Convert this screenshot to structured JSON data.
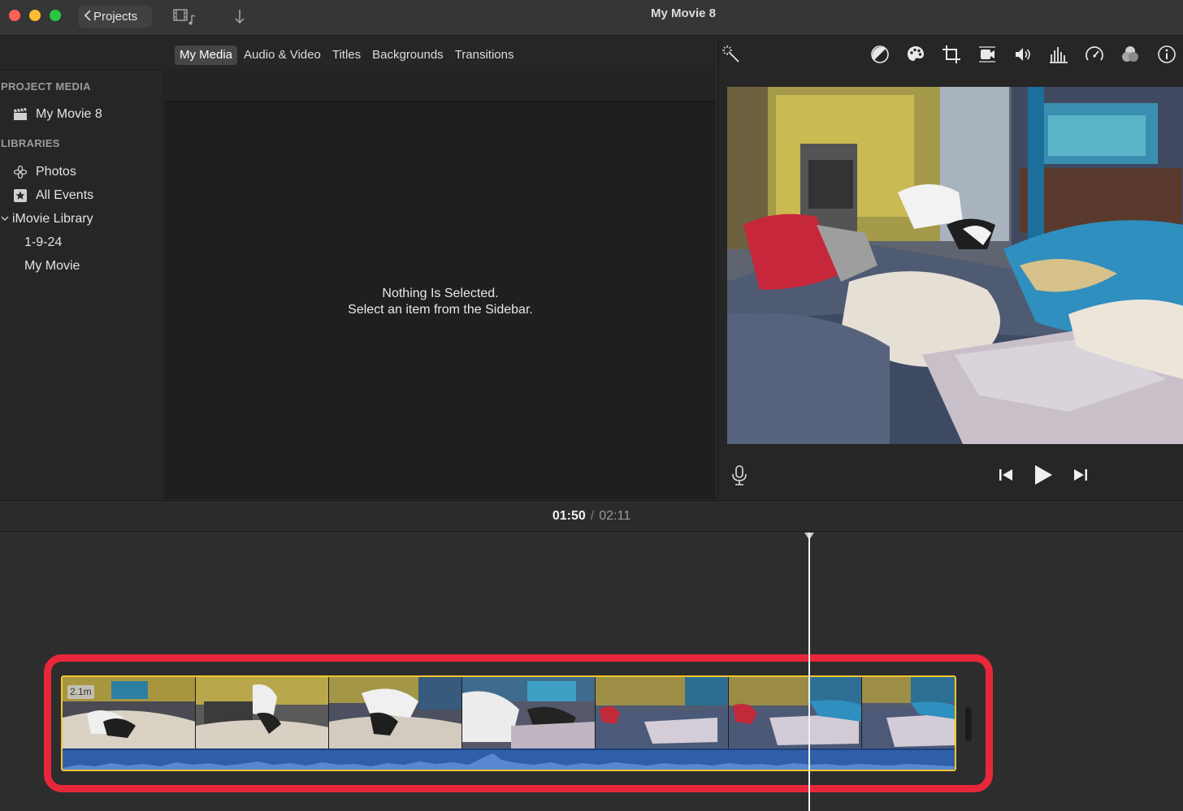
{
  "window": {
    "title": "My Movie 8"
  },
  "toolbar": {
    "projects_label": "Projects"
  },
  "tabs": [
    {
      "label": "My Media",
      "active": true
    },
    {
      "label": "Audio & Video"
    },
    {
      "label": "Titles"
    },
    {
      "label": "Backgrounds"
    },
    {
      "label": "Transitions"
    }
  ],
  "sidebar": {
    "project_media_title": "PROJECT MEDIA",
    "project_item": "My Movie 8",
    "libraries_title": "LIBRARIES",
    "items": [
      {
        "label": "Photos",
        "icon": "photos-icon"
      },
      {
        "label": "All Events",
        "icon": "star-icon"
      },
      {
        "label": "iMovie Library",
        "icon": "chevron-down-icon"
      },
      {
        "label": "1-9-24"
      },
      {
        "label": "My Movie"
      }
    ]
  },
  "browser": {
    "empty_line1": "Nothing Is Selected.",
    "empty_line2": "Select an item from the Sidebar."
  },
  "viewer": {
    "tool_icons": [
      "magic-wand-icon",
      "color-balance-icon",
      "color-palette-icon",
      "crop-icon",
      "stabilize-camera-icon",
      "volume-icon",
      "equalizer-icon",
      "speed-icon",
      "filter-icon",
      "info-icon"
    ],
    "control_icons": [
      "microphone-icon",
      "skip-back-icon",
      "play-icon",
      "skip-forward-icon"
    ]
  },
  "timeline": {
    "current_time": "01:50",
    "separator": "/",
    "total_time": "02:11",
    "clip_badge": "2.1m",
    "clip_border_color": "#f3c430",
    "highlight_color": "#e8283a",
    "playhead_fraction": 0.84
  }
}
